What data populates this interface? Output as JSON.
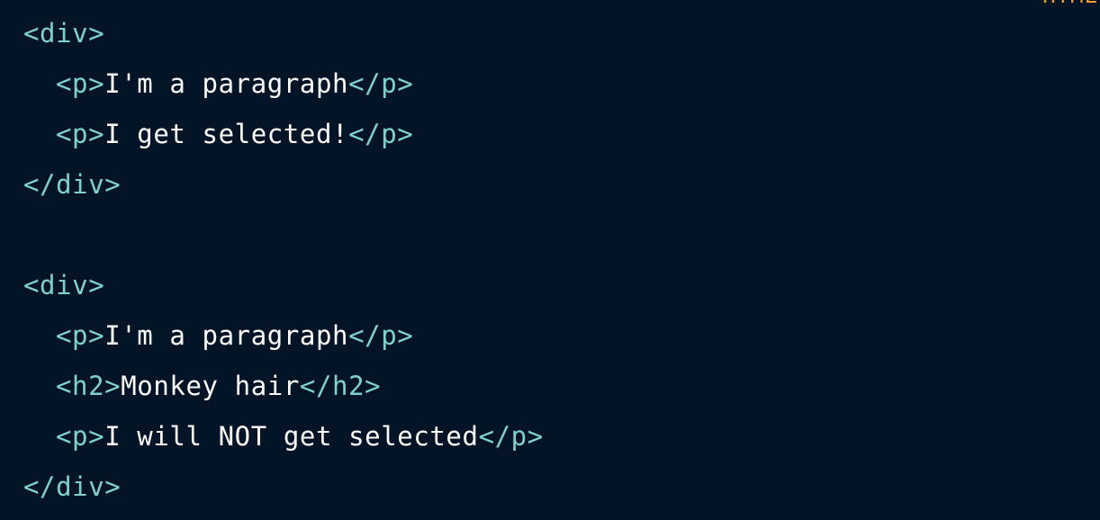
{
  "lang_label": "HTML",
  "colors": {
    "background": "#041427",
    "tag": "#7fd1cb",
    "text": "#ffffff",
    "lang_label": "#f19a2e"
  },
  "lines": [
    {
      "indent": 0,
      "tokens": [
        {
          "type": "tag",
          "text": "<div>"
        }
      ]
    },
    {
      "indent": 1,
      "tokens": [
        {
          "type": "tag",
          "text": "<p>"
        },
        {
          "type": "text",
          "text": "I'm a paragraph"
        },
        {
          "type": "tag",
          "text": "</p>"
        }
      ]
    },
    {
      "indent": 1,
      "tokens": [
        {
          "type": "tag",
          "text": "<p>"
        },
        {
          "type": "text",
          "text": "I get selected!"
        },
        {
          "type": "tag",
          "text": "</p>"
        }
      ]
    },
    {
      "indent": 0,
      "tokens": [
        {
          "type": "tag",
          "text": "</div>"
        }
      ]
    },
    {
      "indent": 0,
      "tokens": []
    },
    {
      "indent": 0,
      "tokens": [
        {
          "type": "tag",
          "text": "<div>"
        }
      ]
    },
    {
      "indent": 1,
      "tokens": [
        {
          "type": "tag",
          "text": "<p>"
        },
        {
          "type": "text",
          "text": "I'm a paragraph"
        },
        {
          "type": "tag",
          "text": "</p>"
        }
      ]
    },
    {
      "indent": 1,
      "tokens": [
        {
          "type": "tag",
          "text": "<h2>"
        },
        {
          "type": "text",
          "text": "Monkey hair"
        },
        {
          "type": "tag",
          "text": "</h2>"
        }
      ]
    },
    {
      "indent": 1,
      "tokens": [
        {
          "type": "tag",
          "text": "<p>"
        },
        {
          "type": "text",
          "text": "I will NOT get selected"
        },
        {
          "type": "tag",
          "text": "</p>"
        }
      ]
    },
    {
      "indent": 0,
      "tokens": [
        {
          "type": "tag",
          "text": "</div>"
        }
      ]
    }
  ]
}
